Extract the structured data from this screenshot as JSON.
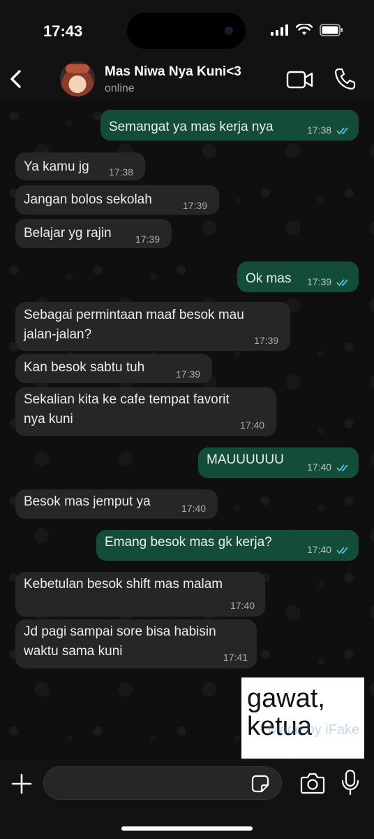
{
  "status_bar": {
    "time": "17:43"
  },
  "header": {
    "contact_name": "Mas Niwa Nya Kuni<3",
    "contact_status": "online"
  },
  "messages": [
    {
      "side": "out",
      "text": "Semangat ya mas kerja nya",
      "time": "17:38",
      "read": true
    },
    {
      "side": "in",
      "text": "Ya kamu jg",
      "time": "17:38"
    },
    {
      "side": "in",
      "text": "Jangan bolos sekolah",
      "time": "17:39"
    },
    {
      "side": "in",
      "text": "Belajar yg rajin",
      "time": "17:39"
    },
    {
      "side": "out",
      "text": "Ok mas",
      "time": "17:39",
      "read": true
    },
    {
      "side": "in",
      "text": "Sebagai permintaan maaf besok mau\njalan-jalan?",
      "time": "17:39"
    },
    {
      "side": "in",
      "text": "Kan besok sabtu tuh",
      "time": "17:39"
    },
    {
      "side": "in",
      "text": "Sekalian kita ke cafe tempat favorit\nnya kuni",
      "time": "17:40"
    },
    {
      "side": "out",
      "text": "MAUUUUUU",
      "time": "17:40",
      "read": true
    },
    {
      "side": "in",
      "text": "Besok mas jemput ya",
      "time": "17:40"
    },
    {
      "side": "out",
      "text": "Emang besok mas gk kerja?",
      "time": "17:40",
      "read": true
    },
    {
      "side": "in",
      "text": "Kebetulan besok shift mas malam",
      "time": "17:40"
    },
    {
      "side": "in",
      "text": "Jd pagi sampai sore bisa habisin\nwaktu sama kuni",
      "time": "17:41"
    }
  ],
  "sticker": {
    "text": "gawat,\nketua",
    "watermark": "Made by iFake"
  },
  "composer": {
    "placeholder": ""
  },
  "colors": {
    "incoming_bubble": "#262626",
    "outgoing_bubble": "#144d37",
    "read_ticks": "#53bdeb"
  }
}
